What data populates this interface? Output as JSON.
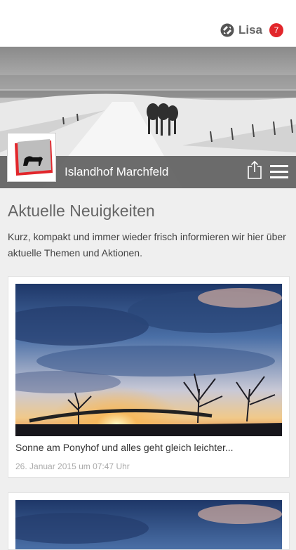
{
  "header": {
    "user_name": "Lisa",
    "notification_count": "7"
  },
  "hero": {
    "title": "Islandhof Marchfeld"
  },
  "main": {
    "title": "Aktuelle Neuigkeiten",
    "intro": "Kurz, kompakt und immer wieder frisch informieren wir hier über aktuelle Themen und Aktionen.",
    "posts": [
      {
        "caption": "Sonne am Ponyhof und alles geht gleich leichter...",
        "date": "26. Januar 2015 um 07:47 Uhr"
      }
    ]
  },
  "colors": {
    "accent": "#e2262b",
    "bar": "#5f5f5f",
    "background": "#efefef"
  },
  "icons": {
    "user_logo": "app-logo-icon",
    "share": "share-icon",
    "menu": "hamburger-menu-icon"
  }
}
